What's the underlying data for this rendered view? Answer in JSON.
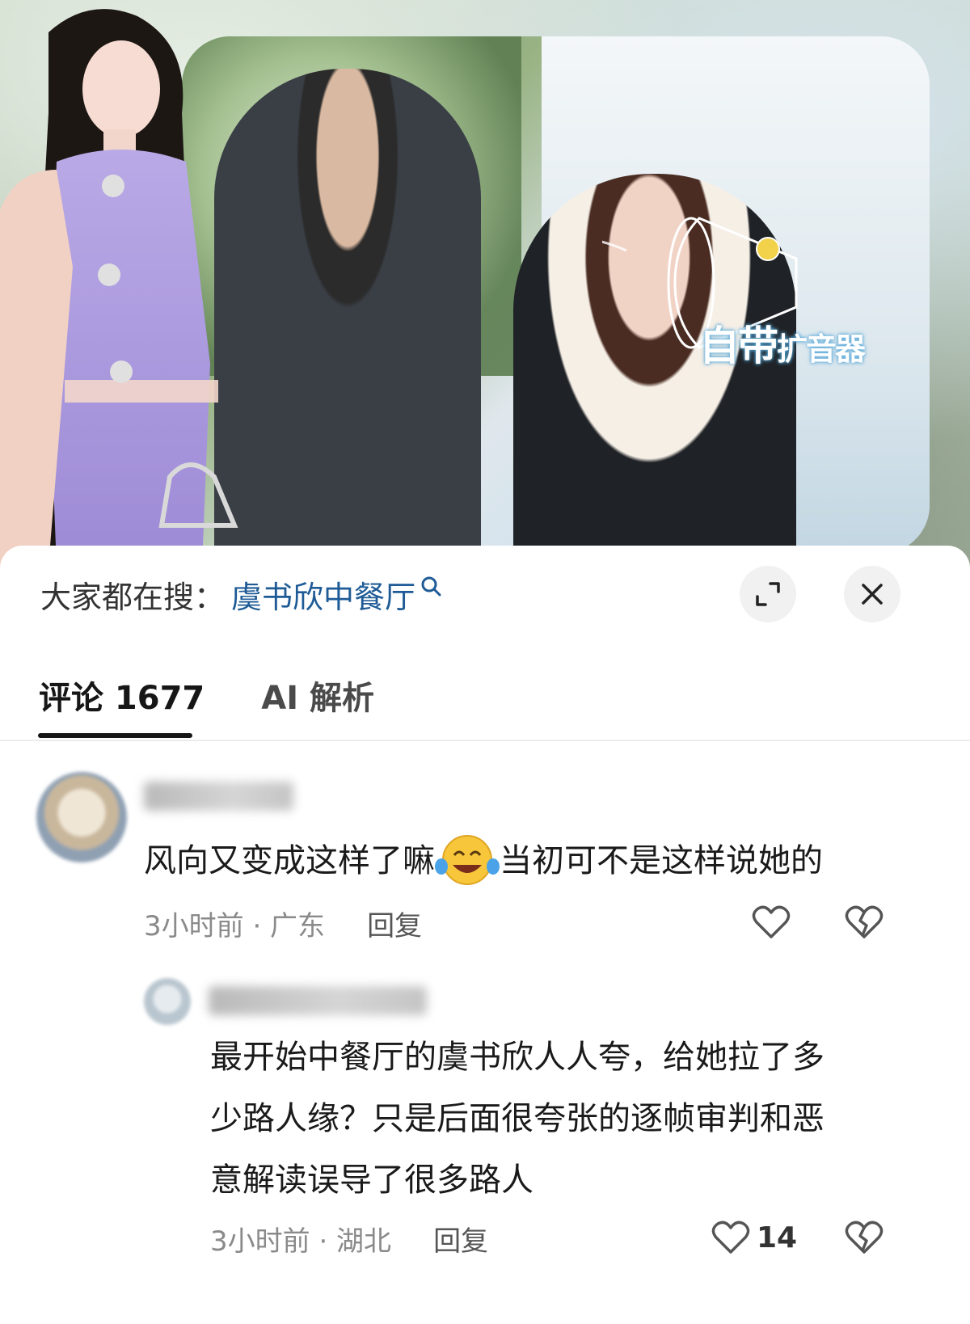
{
  "video": {
    "caption_line1": "自带",
    "caption_line2": "扩音器"
  },
  "search": {
    "label": "大家都在搜：",
    "term": "虞书欣中餐厅"
  },
  "tabs": [
    {
      "label": "评论 1677",
      "active": true
    },
    {
      "label": "AI 解析",
      "active": false
    }
  ],
  "comments": [
    {
      "text_before_emoji": "风向又变成这样了嘛",
      "emoji": "laughing-crying-emoji",
      "text_after_emoji": "当初可不是这样说她的",
      "time": "3小时前 · 广东",
      "reply_label": "回复",
      "like_count": ""
    }
  ],
  "replies": [
    {
      "text_line1": "最开始中餐厅的虞书欣人人夸，给她拉了多",
      "text_line2": "少路人缘？只是后面很夸张的逐帧审判和恶",
      "text_line3": "意解读误导了很多路人",
      "time": "3小时前 · 湖北",
      "reply_label": "回复",
      "like_count": "14"
    }
  ],
  "colors": {
    "search_term": "#1e5b96",
    "active_tab": "#161616",
    "meta_text": "#8a8a8a"
  }
}
